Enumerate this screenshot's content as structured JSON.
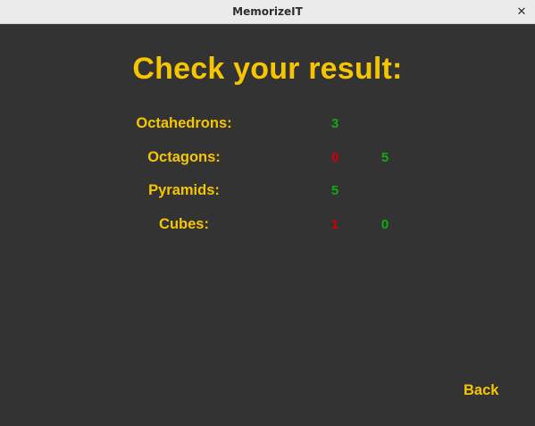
{
  "window": {
    "title": "MemorizeIT",
    "close_glyph": "✕"
  },
  "heading": "Check your result:",
  "results": [
    {
      "label": "Octahedrons:",
      "first": "3",
      "first_color": "green",
      "second": ""
    },
    {
      "label": "Octagons:",
      "first": "0",
      "first_color": "red",
      "second": "5",
      "second_color": "green"
    },
    {
      "label": "Pyramids:",
      "first": "5",
      "first_color": "green",
      "second": ""
    },
    {
      "label": "Cubes:",
      "first": "1",
      "first_color": "red",
      "second": "0",
      "second_color": "green"
    }
  ],
  "back_label": "Back",
  "colors": {
    "background": "#333333",
    "accent": "#f5c600",
    "correct": "#14a814",
    "wrong": "#d10000"
  }
}
